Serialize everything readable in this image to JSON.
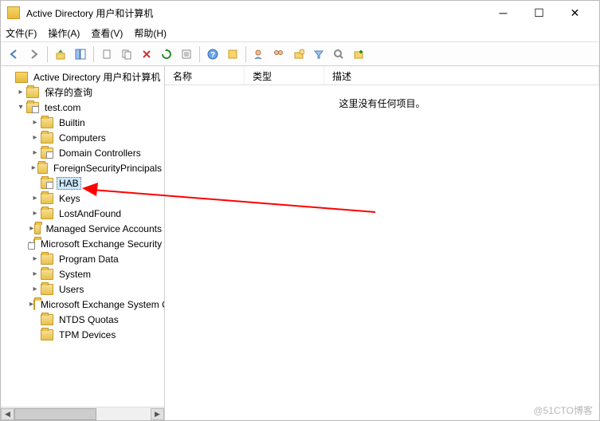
{
  "window": {
    "title": "Active Directory 用户和计算机"
  },
  "menu": {
    "file": "文件(F)",
    "action": "操作(A)",
    "view": "查看(V)",
    "help": "帮助(H)"
  },
  "tree": {
    "root": "Active Directory 用户和计算机",
    "saved": "保存的查询",
    "domain": "test.com",
    "children": {
      "builtin": "Builtin",
      "computers": "Computers",
      "dcs": "Domain Controllers",
      "fsp": "ForeignSecurityPrincipals",
      "hab": "HAB",
      "keys": "Keys",
      "laf": "LostAndFound",
      "msa": "Managed Service Accounts",
      "mes": "Microsoft Exchange Security Groups",
      "pd": "Program Data",
      "system": "System",
      "users": "Users",
      "meso": "Microsoft Exchange System Objects",
      "ntds": "NTDS Quotas",
      "tpm": "TPM Devices"
    }
  },
  "columns": {
    "name": "名称",
    "type": "类型",
    "desc": "描述"
  },
  "empty": "这里没有任何项目。",
  "watermark": "@51CTO博客"
}
